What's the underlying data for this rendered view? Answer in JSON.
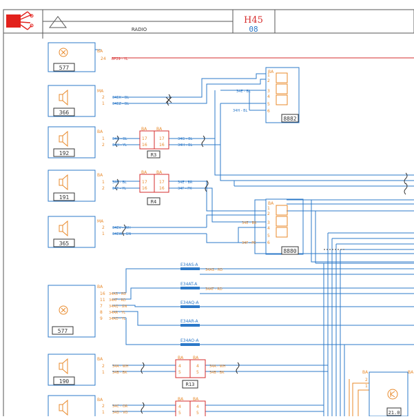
{
  "header": {
    "title": "RADIO",
    "code": "H45",
    "page": "08"
  },
  "components": [
    {
      "id": "577",
      "symbol": "radio"
    },
    {
      "id": "366",
      "symbol": "speaker"
    },
    {
      "id": "192",
      "symbol": "speaker"
    },
    {
      "id": "191",
      "symbol": "speaker"
    },
    {
      "id": "365",
      "symbol": "speaker"
    },
    {
      "id": "577",
      "symbol": "radio"
    },
    {
      "id": "190",
      "symbol": "speaker"
    },
    {
      "id": "",
      "symbol": "speaker"
    }
  ],
  "connectors": [
    {
      "id": "R3"
    },
    {
      "id": "R4"
    },
    {
      "id": "R13"
    },
    {
      "id": "8882"
    },
    {
      "id": "8880"
    },
    {
      "id": "21.0"
    }
  ],
  "splices": [
    "E34AS-A",
    "E34AT-A",
    "E34AQ-A",
    "E34AR-A",
    "E34AO-A"
  ],
  "wire_labels": {
    "w577a": [
      "BA",
      "24",
      "BP29 - YL"
    ],
    "w366": [
      "MA",
      "2",
      "34EX - BL",
      "1",
      "34EZ - BL"
    ],
    "w8882": [
      "BA",
      "34E - BL",
      "34H - BL",
      "1",
      "2",
      "3",
      "4",
      "5",
      "6"
    ],
    "w192": [
      "BA",
      "1",
      "34G - BL",
      "2",
      "34H - YL",
      "BA",
      "BA",
      "17",
      "16",
      "17",
      "16",
      "34G - BL",
      "34H - BL"
    ],
    "w191": [
      "BA",
      "1",
      "34E - BL",
      "2",
      "34F - YL",
      "BA",
      "BA",
      "17",
      "16",
      "17",
      "16",
      "34E - BR",
      "34F - PK"
    ],
    "w8880": [
      "BA",
      "34E - BR",
      "34F - PK",
      "1",
      "2",
      "3",
      "4",
      "5",
      "6"
    ],
    "w365": [
      "MA",
      "2",
      "34EV - WH",
      "1",
      "34EW - GN"
    ],
    "w577b": [
      "BA",
      "16",
      "34AS - RD",
      "11",
      "34AT - RD",
      "7",
      "34AQ - GN",
      "8",
      "34AR - YL",
      "9",
      "34AO - YL",
      "34AS - RD",
      "34AT - RD"
    ],
    "w190": [
      "BA",
      "2",
      "34A - WH",
      "1",
      "34B - BK",
      "BA",
      "BA",
      "4",
      "5",
      "4",
      "5",
      "34A - WH",
      "34B - BK"
    ],
    "wlast": [
      "BA",
      "2",
      "34C - OR",
      "1",
      "34D - VO",
      "BA",
      "BA",
      "4",
      "5",
      "4",
      "5",
      "BA",
      "BA",
      "2",
      "1"
    ]
  },
  "colors": {
    "blue": "#2b78c8",
    "red": "#d62b2b",
    "orange": "#e8892a",
    "dark": "#333333"
  }
}
